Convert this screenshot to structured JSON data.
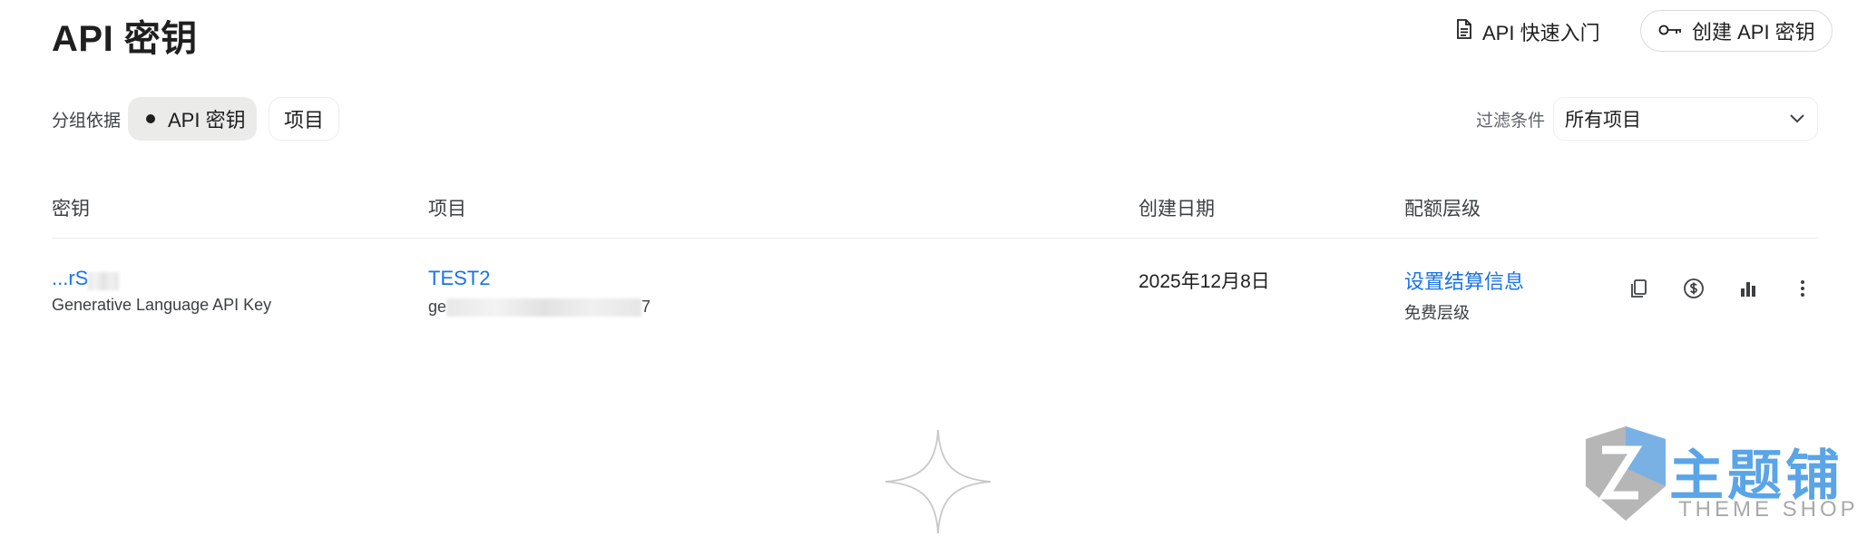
{
  "header": {
    "title": "API 密钥",
    "quickstart_label": "API 快速入门",
    "create_label": "创建 API 密钥"
  },
  "toolbar": {
    "group_by_label": "分组依据",
    "group_options": [
      {
        "label": "API 密钥",
        "selected": true
      },
      {
        "label": "项目",
        "selected": false
      }
    ],
    "filter_label": "过滤条件",
    "filter_value": "所有项目"
  },
  "table": {
    "columns": [
      "密钥",
      "项目",
      "创建日期",
      "配额层级"
    ],
    "rows": [
      {
        "key_display": "...rS",
        "key_name": "Generative Language API Key",
        "project_name": "TEST2",
        "project_id_prefix": "ge",
        "project_id_suffix": "7",
        "created": "2025年12月8日",
        "quota_link": "设置结算信息",
        "quota_tier": "免费层级"
      }
    ]
  },
  "row_actions": [
    "copy-icon",
    "billing-icon",
    "usage-chart-icon",
    "more-vert-icon"
  ],
  "watermark": {
    "text": "主题铺",
    "sub": "THEME SHOP"
  },
  "colors": {
    "link": "#1a73e8",
    "chip_selected_bg": "#ebebea",
    "watermark_blue": "#5aa4e8"
  }
}
